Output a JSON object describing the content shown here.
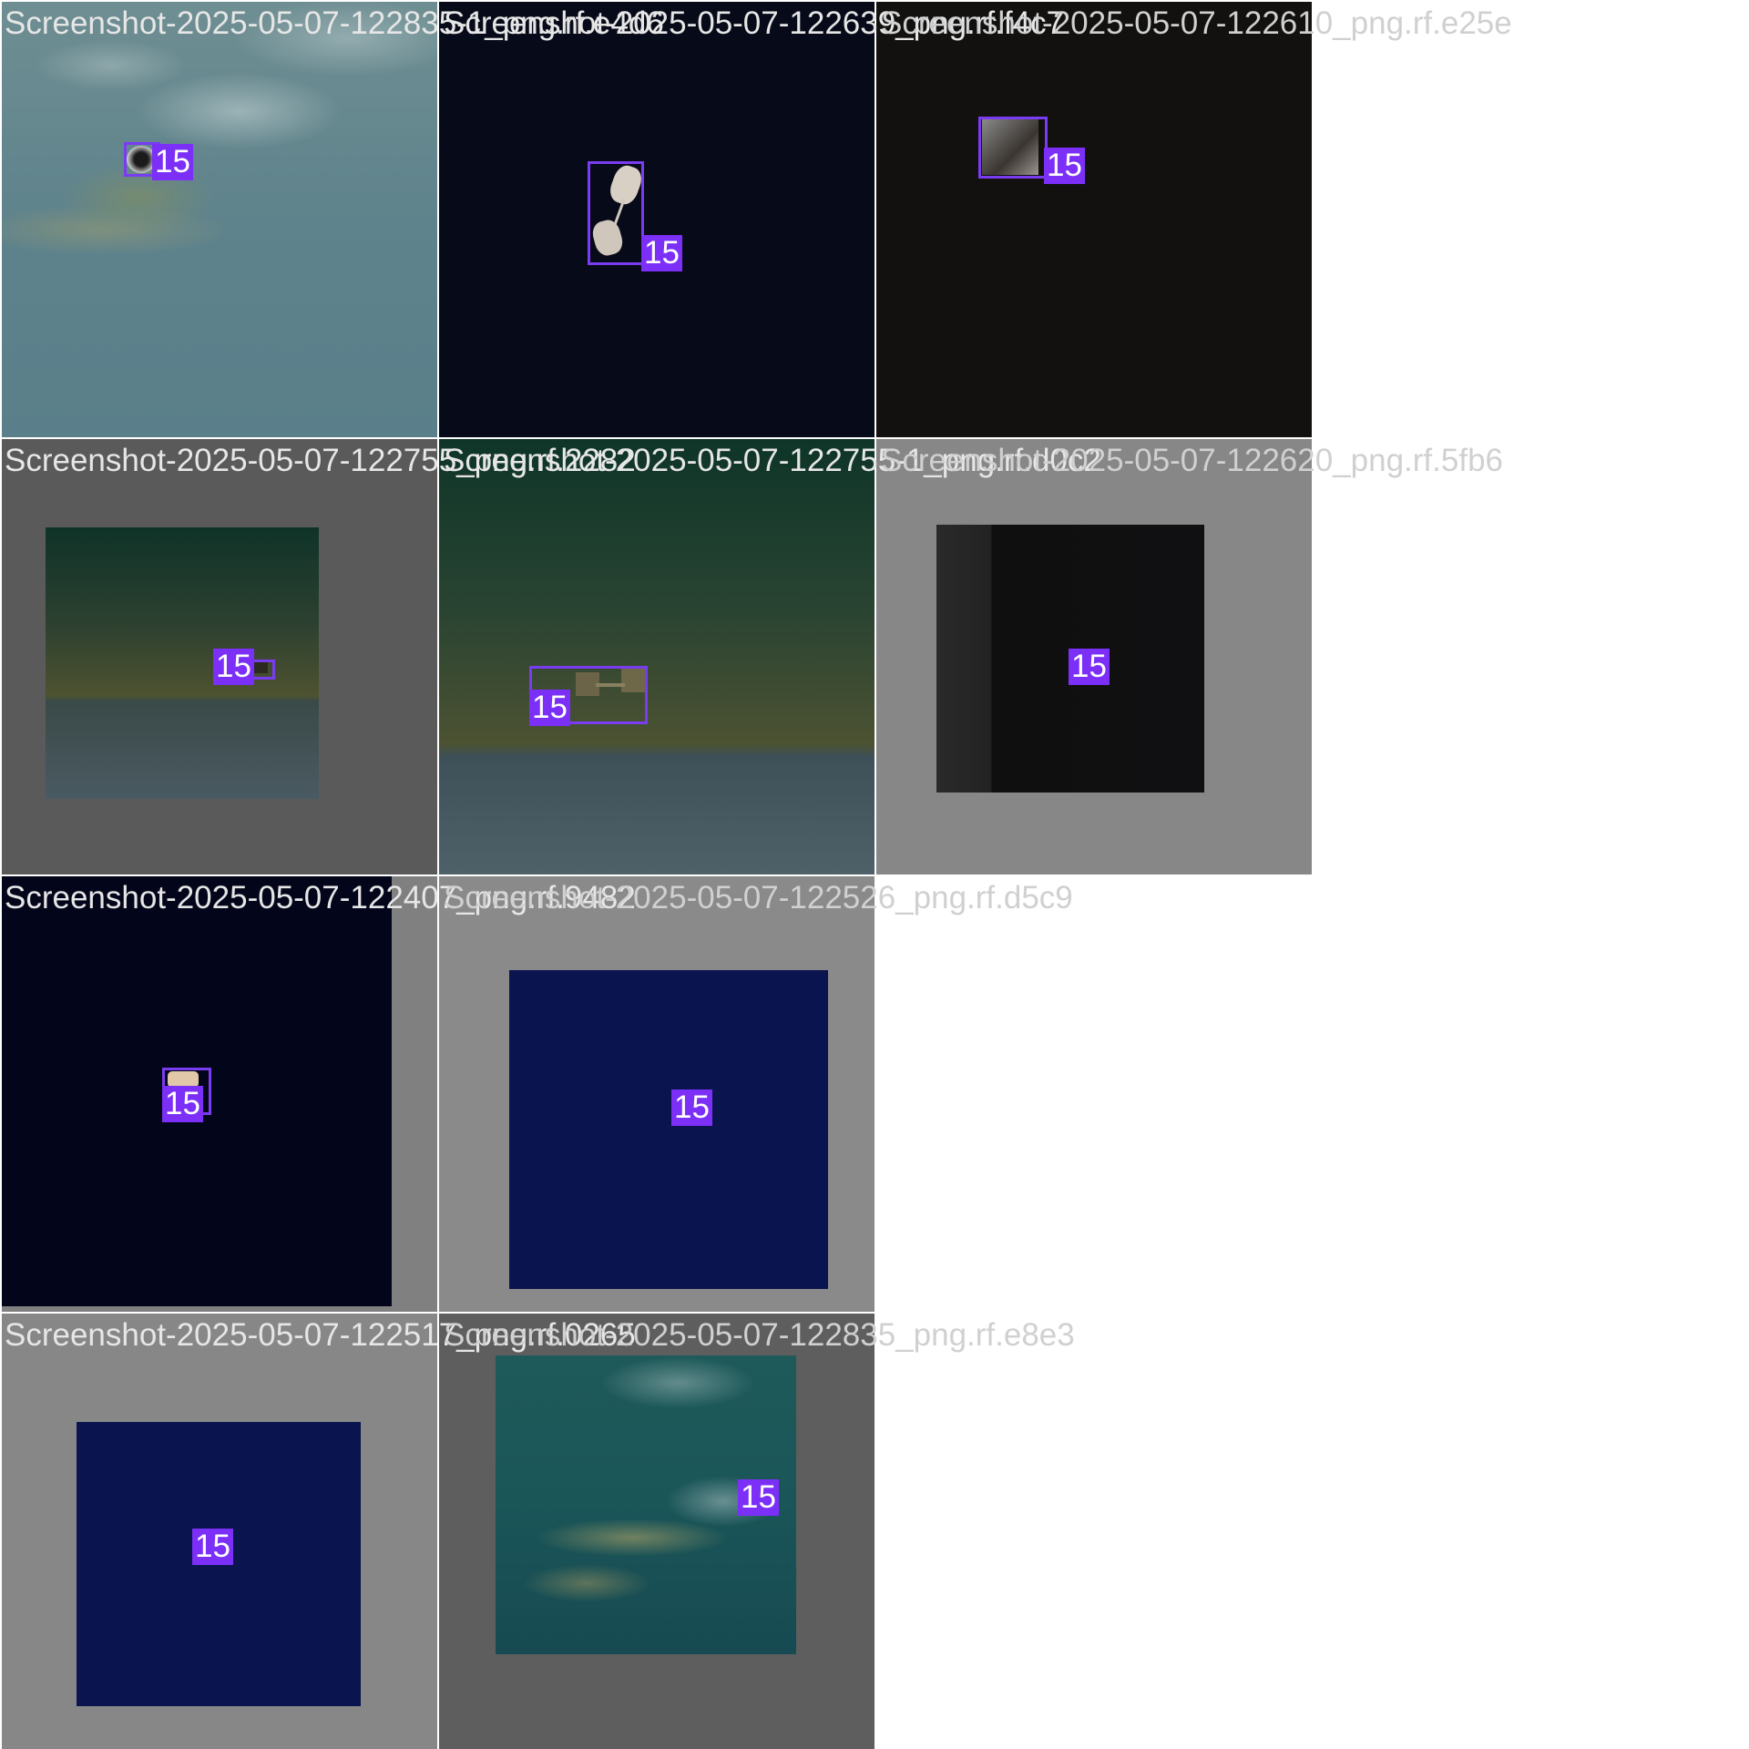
{
  "tiles": [
    {
      "caption": "Screenshot-2025-05-07-122835-1_png.rf.e4d6",
      "class_id": "15"
    },
    {
      "caption": "Screenshot-2025-05-07-122639_png.rf.f4c7",
      "class_id": "15"
    },
    {
      "caption": "Screenshot-2025-05-07-122610_png.rf.e25e",
      "class_id": "15"
    },
    {
      "caption": "Screenshot-2025-05-07-122755_png.rf.2282",
      "class_id": "15"
    },
    {
      "caption": "Screenshot-2025-05-07-122755-1_png.rf.d0c2",
      "class_id": "15"
    },
    {
      "caption": "Screenshot-2025-05-07-122620_png.rf.5fb6",
      "class_id": "15"
    },
    {
      "caption": "Screenshot-2025-05-07-122407_png.rf.9482",
      "class_id": "15"
    },
    {
      "caption": "Screenshot-2025-05-07-122526_png.rf.d5c9",
      "class_id": "15"
    },
    {
      "caption": "Screenshot-2025-05-07-122517_png.rf.0265",
      "class_id": "15"
    },
    {
      "caption": "Screenshot-2025-05-07-122835_png.rf.e8e3",
      "class_id": "15"
    }
  ],
  "colors": {
    "box_outline": "#7a3cf0",
    "label_background": "#7b2ff7",
    "label_text": "#ffffff",
    "padding_gray": "#808080"
  }
}
